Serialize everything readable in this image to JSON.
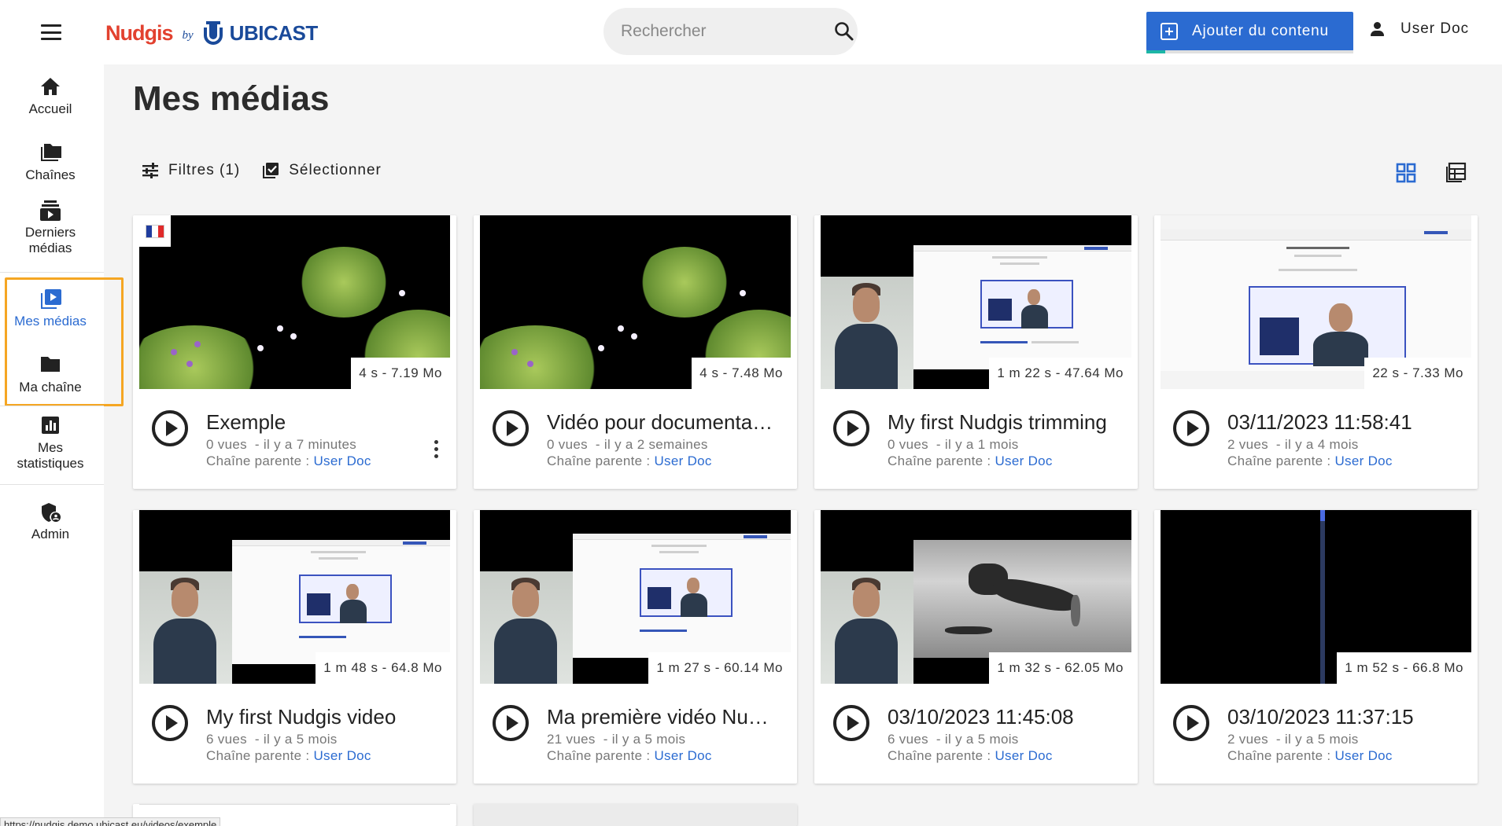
{
  "app": {
    "brand": "Nudgis",
    "by": "by",
    "company": "UBICAST"
  },
  "search": {
    "placeholder": "Rechercher"
  },
  "header": {
    "add_content_label": "Ajouter du contenu",
    "user_name": "User Doc"
  },
  "sidebar": {
    "items": [
      {
        "label": "Accueil",
        "icon": "home-icon"
      },
      {
        "label": "Chaînes",
        "icon": "folders-icon"
      },
      {
        "label_line1": "Derniers",
        "label_line2": "médias",
        "icon": "recent-media-icon"
      },
      {
        "label": "Mes médias",
        "icon": "my-media-icon",
        "active": true
      },
      {
        "label": "Ma chaîne",
        "icon": "folder-icon"
      },
      {
        "label_line1": "Mes",
        "label_line2": "statistiques",
        "icon": "stats-icon"
      },
      {
        "label": "Admin",
        "icon": "admin-shield-icon"
      }
    ]
  },
  "main": {
    "title": "Mes médias",
    "filters_label": "Filtres (1)",
    "select_label": "Sélectionner",
    "views": [
      "grid-view-icon",
      "list-view-icon"
    ]
  },
  "media": [
    {
      "title": "Exemple",
      "duration": "4 s - 7.19 Mo",
      "views": "0 vues",
      "age": "il y a 7 minutes",
      "channel_prefix": "Chaîne parente :",
      "channel": "User Doc",
      "lang_flag": "fr",
      "thumb": "garden",
      "has_menu": true
    },
    {
      "title": "Vidéo pour documentation",
      "duration": "4 s - 7.48 Mo",
      "views": "0 vues",
      "age": "il y a 2 semaines",
      "channel_prefix": "Chaîne parente :",
      "channel": "User Doc",
      "thumb": "garden"
    },
    {
      "title": "My first Nudgis trimming",
      "duration": "1 m 22 s - 47.64 Mo",
      "views": "0 vues",
      "age": "il y a 1 mois",
      "channel_prefix": "Chaîne parente :",
      "channel": "User Doc",
      "thumb": "screen"
    },
    {
      "title": "03/11/2023 11:58:41",
      "duration": "22 s - 7.33 Mo",
      "views": "2 vues",
      "age": "il y a 4 mois",
      "channel_prefix": "Chaîne parente :",
      "channel": "User Doc",
      "thumb": "website"
    },
    {
      "title": "My first Nudgis video",
      "duration": "1 m 48 s - 64.8 Mo",
      "views": "6 vues",
      "age": "il y a 5 mois",
      "channel_prefix": "Chaîne parente :",
      "channel": "User Doc",
      "thumb": "screen"
    },
    {
      "title": "Ma première vidéo Nudgis",
      "duration": "1 m 27 s - 60.14 Mo",
      "views": "21 vues",
      "age": "il y a 5 mois",
      "channel_prefix": "Chaîne parente :",
      "channel": "User Doc",
      "thumb": "screen"
    },
    {
      "title": "03/10/2023 11:45:08",
      "duration": "1 m 32 s - 62.05 Mo",
      "views": "6 vues",
      "age": "il y a 5 mois",
      "channel_prefix": "Chaîne parente :",
      "channel": "User Doc",
      "thumb": "skate"
    },
    {
      "title": "03/10/2023 11:37:15",
      "duration": "1 m 52 s - 66.8 Mo",
      "views": "2 vues",
      "age": "il y a 5 mois",
      "channel_prefix": "Chaîne parente :",
      "channel": "User Doc",
      "thumb": "empty"
    }
  ],
  "status_bar": {
    "url": "https://nudgis.demo.ubicast.eu/videos/exemple"
  },
  "colors": {
    "accent": "#2b6bd1",
    "brand_red": "#e2412f",
    "focus": "#f5a623",
    "teal": "#1db6a6"
  }
}
